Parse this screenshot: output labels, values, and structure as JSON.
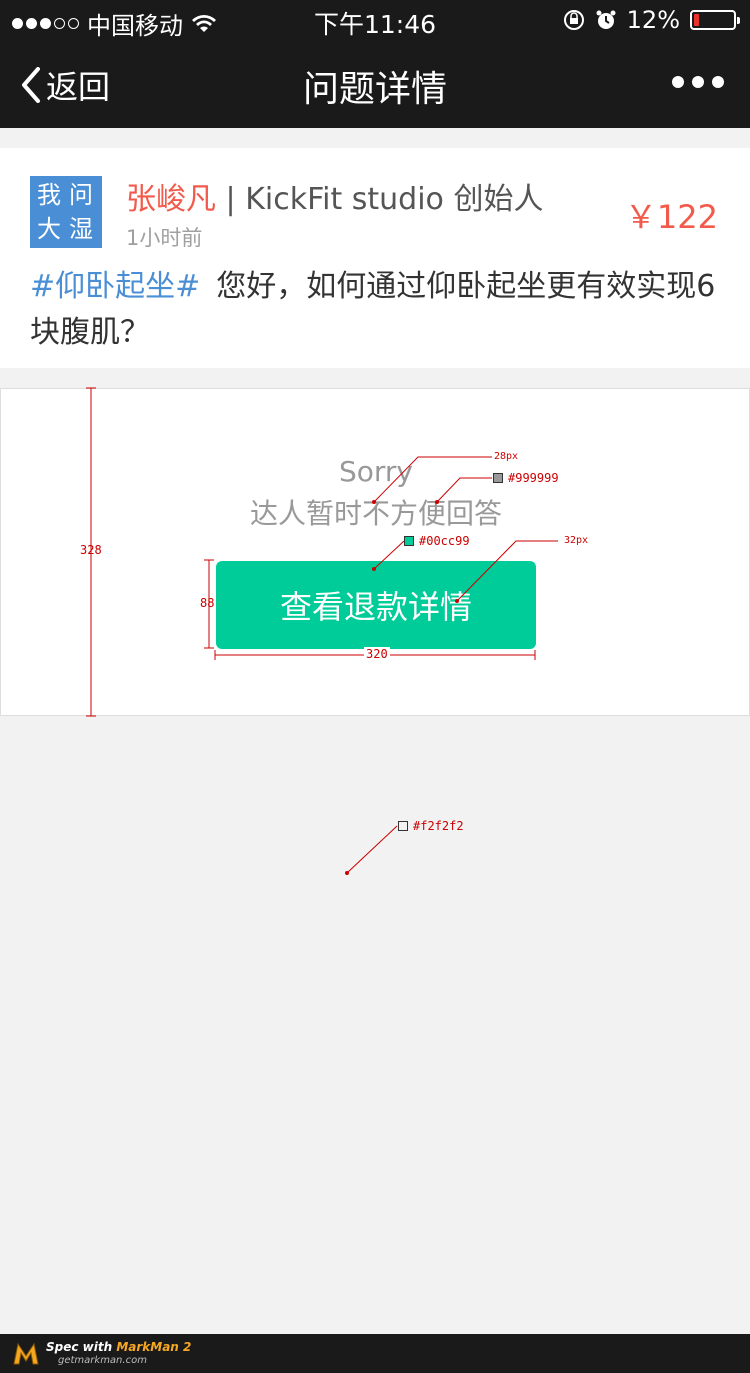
{
  "status_bar": {
    "carrier": "中国移动",
    "time": "下午11:46",
    "battery_percent": "12%",
    "battery_level": 0.12,
    "signal_icon": "signal-dots-icon",
    "wifi_icon": "wifi-icon"
  },
  "nav": {
    "back_label": "返回",
    "title": "问题详情",
    "more_icon": "more-dots-icon"
  },
  "question": {
    "logo_lines": [
      "我问",
      "大湿"
    ],
    "author_name": "张峻凡",
    "author_sep": " | ",
    "author_title": "KickFit studio 创始人",
    "time": "1小时前",
    "price": "￥122",
    "tag": "#仰卧起坐#",
    "text": "您好，如何通过仰卧起坐更有效实现6块腹肌？"
  },
  "answer": {
    "sorry": "Sorry",
    "message": "达人暂时不方便回答",
    "button_label": "查看退款详情"
  },
  "annotations": {
    "height_328": "328",
    "height_88": "88",
    "width_320": "320",
    "font_28": "28px",
    "font_32": "32px",
    "color_999": "#999999",
    "color_00cc99": "#00cc99",
    "color_f2f2f2": "#f2f2f2"
  },
  "colors": {
    "accent_green": "#00cc99",
    "text_gray": "#999999",
    "background": "#f2f2f2",
    "price_red": "#f25a4b",
    "tag_blue": "#4a8fd6"
  },
  "footer": {
    "spec_text": "Spec with ",
    "brand": "MarkMan 2",
    "url": "getmarkman.com"
  }
}
